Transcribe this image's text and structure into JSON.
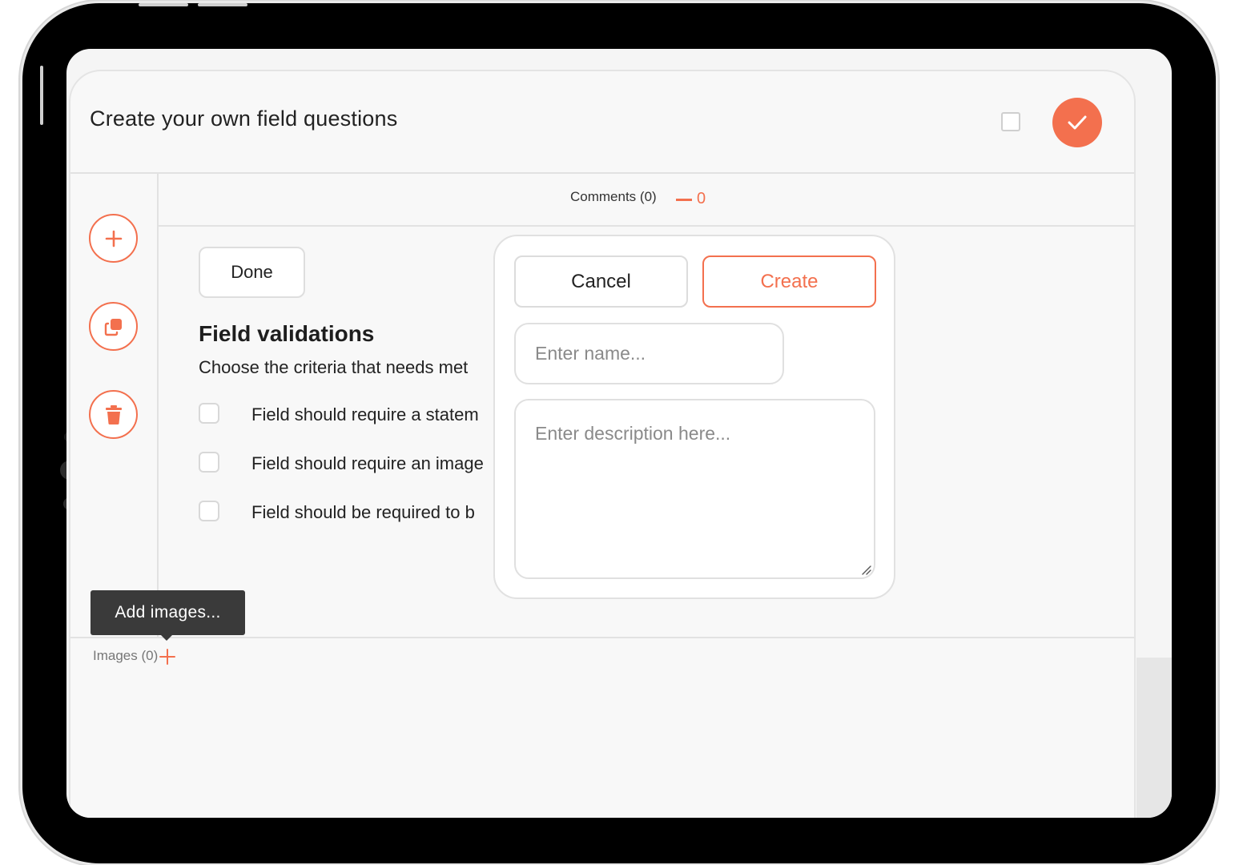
{
  "header": {
    "title": "Create your own field questions"
  },
  "comments": {
    "label": "Comments (0)",
    "count": "0"
  },
  "editor": {
    "done_label": "Done",
    "section_title": "Field validations",
    "section_desc": "Choose the criteria that needs met",
    "validations": [
      {
        "label": "Field should require a statem",
        "checked": false
      },
      {
        "label": "Field should require an image",
        "checked": false
      },
      {
        "label": "Field should be required to b",
        "checked": false
      }
    ]
  },
  "images": {
    "label": "Images (0)",
    "tooltip": "Add images..."
  },
  "popup": {
    "cancel_label": "Cancel",
    "create_label": "Create",
    "name_placeholder": "Enter name...",
    "description_placeholder": "Enter description here..."
  },
  "colors": {
    "accent": "#f3704e",
    "tooltip_bg": "#3a3a3a"
  },
  "icons": {
    "confirm": "checkmark-icon",
    "add": "plus-icon",
    "copy": "copy-icon",
    "delete": "trash-icon",
    "comments_collapse": "minus-icon",
    "images_add": "plus-icon"
  }
}
